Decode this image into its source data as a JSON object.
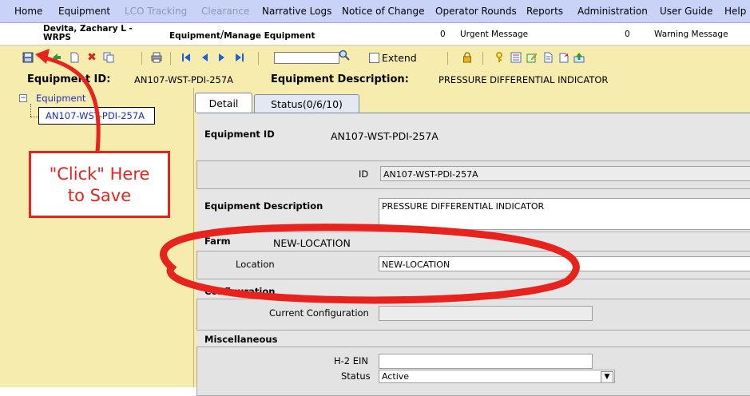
{
  "menu": {
    "items": [
      {
        "label": "Home",
        "enabled": true
      },
      {
        "label": "Equipment",
        "enabled": true
      },
      {
        "label": "LCO Tracking",
        "enabled": false
      },
      {
        "label": "Clearance",
        "enabled": false
      },
      {
        "label": "Narrative Logs",
        "enabled": true
      },
      {
        "label": "Notice of Change",
        "enabled": true
      },
      {
        "label": "Operator Rounds",
        "enabled": true
      },
      {
        "label": "Reports",
        "enabled": true
      },
      {
        "label": "Administration",
        "enabled": true
      },
      {
        "label": "User Guide",
        "enabled": true
      },
      {
        "label": "Help",
        "enabled": true
      }
    ]
  },
  "userbar": {
    "user_line1": "Devita, Zachary L -",
    "user_line2": "WRPS",
    "breadcrumb_part1": "Equipment",
    "breadcrumb_sep": "/",
    "breadcrumb_part2": "Manage Equipment",
    "urgent_count": "0",
    "urgent_label": "Urgent Message",
    "warning_count": "0",
    "warning_label": "Warning Message"
  },
  "toolbar": {
    "search_value": "",
    "extend_label": "Extend",
    "extend_checked": false,
    "icons": [
      "save-icon",
      "forward-green-icon",
      "new-document-icon",
      "delete-icon",
      "copy-icon",
      "print-icon",
      "first-record-icon",
      "previous-record-icon",
      "next-record-icon",
      "last-record-icon",
      "search-icon",
      "lock-icon",
      "key-icon",
      "checklist-icon",
      "edit-icon",
      "report-icon",
      "export-icon",
      "upload-icon"
    ]
  },
  "header": {
    "equipment_id_label": "Equipment ID:",
    "equipment_id_value": "AN107-WST-PDI-257A",
    "equipment_desc_label": "Equipment Description:",
    "equipment_desc_value": "PRESSURE DIFFERENTIAL INDICATOR"
  },
  "tree": {
    "root_label": "Equipment",
    "child_label": "AN107-WST-PDI-257A"
  },
  "tabs": [
    {
      "label": "Detail",
      "active": true
    },
    {
      "label": "Status(0/6/10)",
      "active": false
    }
  ],
  "detail": {
    "equipment_id_heading": "Equipment ID",
    "equipment_id_display": "AN107-WST-PDI-257A",
    "id_label": "ID",
    "id_value": "AN107-WST-PDI-257A",
    "desc_heading": "Equipment Description",
    "desc_value": "PRESSURE DIFFERENTIAL INDICATOR",
    "farm_heading": "Farm",
    "farm_value": "NEW-LOCATION",
    "location_label": "Location",
    "location_value": "NEW-LOCATION",
    "config_heading": "Configuration",
    "current_config_label": "Current Configuration",
    "current_config_value": "",
    "misc_heading": "Miscellaneous",
    "h2ein_label": "H-2 EIN",
    "h2ein_value": "",
    "status_label": "Status",
    "status_value": "Active"
  },
  "annotation": {
    "callout_line1": "\"Click\" Here",
    "callout_line2": "to Save",
    "color": "#e8231d"
  }
}
